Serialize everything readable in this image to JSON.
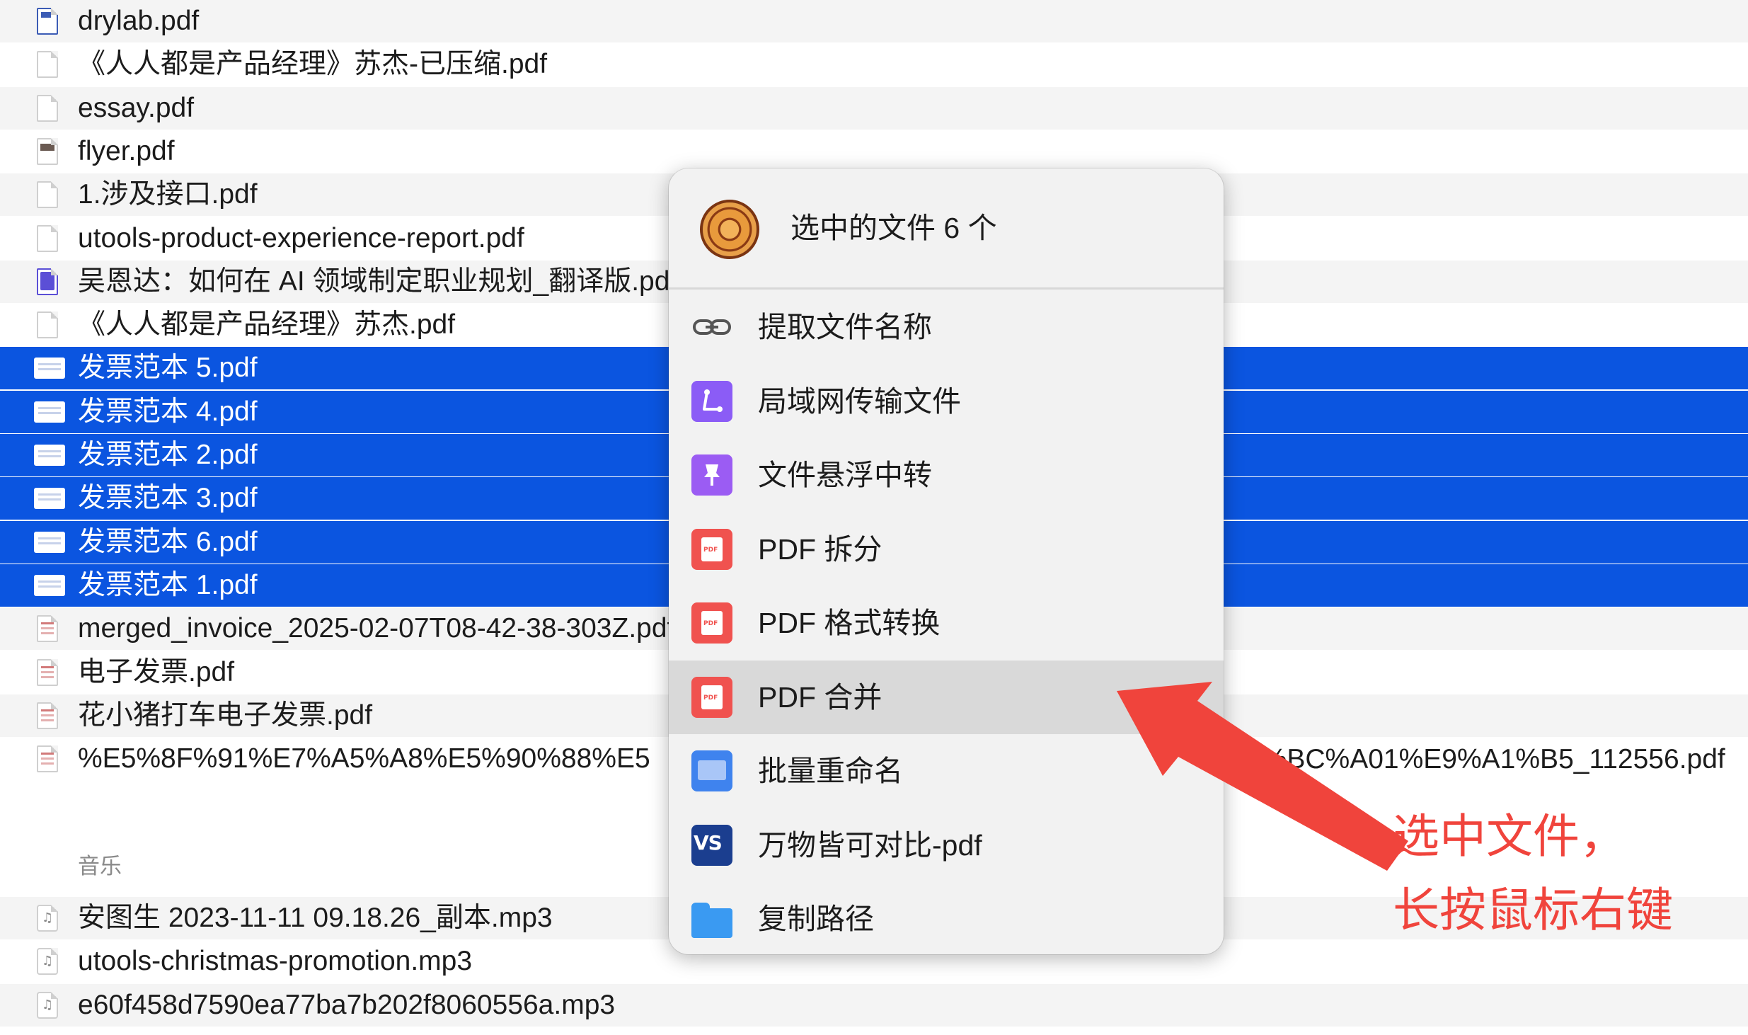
{
  "files": [
    {
      "name": "drylab.pdf",
      "icon": "pdf-doc-icon",
      "variant": "pdf-blue",
      "stripe": true,
      "selected": false
    },
    {
      "name": "《人人都是产品经理》苏杰-已压缩.pdf",
      "icon": "pdf-doc-icon",
      "variant": "",
      "stripe": false,
      "selected": false
    },
    {
      "name": "essay.pdf",
      "icon": "pdf-doc-icon",
      "variant": "",
      "stripe": true,
      "selected": false
    },
    {
      "name": "flyer.pdf",
      "icon": "pdf-doc-icon",
      "variant": "pdf-photo",
      "stripe": false,
      "selected": false
    },
    {
      "name": "1.涉及接口.pdf",
      "icon": "pdf-doc-icon",
      "variant": "",
      "stripe": true,
      "selected": false
    },
    {
      "name": "utools-product-experience-report.pdf",
      "icon": "pdf-doc-icon",
      "variant": "",
      "stripe": false,
      "selected": false
    },
    {
      "name": "吴恩达：如何在 AI 领域制定职业规划_翻译版.pdf",
      "icon": "pdf-doc-icon",
      "variant": "pdf-purple",
      "stripe": true,
      "selected": false
    },
    {
      "name": "《人人都是产品经理》苏杰.pdf",
      "icon": "pdf-doc-icon",
      "variant": "",
      "stripe": false,
      "selected": false
    },
    {
      "name": "发票范本 5.pdf",
      "icon": "invoice-icon",
      "variant": "",
      "stripe": false,
      "selected": true
    },
    {
      "name": "发票范本 4.pdf",
      "icon": "invoice-icon",
      "variant": "",
      "stripe": false,
      "selected": true
    },
    {
      "name": "发票范本 2.pdf",
      "icon": "invoice-icon",
      "variant": "",
      "stripe": false,
      "selected": true
    },
    {
      "name": "发票范本 3.pdf",
      "icon": "invoice-icon",
      "variant": "",
      "stripe": false,
      "selected": true
    },
    {
      "name": "发票范本 6.pdf",
      "icon": "invoice-icon",
      "variant": "",
      "stripe": false,
      "selected": true
    },
    {
      "name": "发票范本 1.pdf",
      "icon": "invoice-icon",
      "variant": "",
      "stripe": false,
      "selected": true
    },
    {
      "name": "merged_invoice_2025-02-07T08-42-38-303Z.pdf",
      "icon": "invoice-icon",
      "variant": "invoice",
      "stripe": true,
      "selected": false
    },
    {
      "name": "电子发票.pdf",
      "icon": "invoice-icon",
      "variant": "invoice",
      "stripe": false,
      "selected": false
    },
    {
      "name": "花小猪打车电子发票.pdf",
      "icon": "invoice-icon",
      "variant": "invoice",
      "stripe": true,
      "selected": false
    },
    {
      "name": "%E5%8F%91%E7%A5%A8%E5%90%88%E5",
      "icon": "invoice-icon",
      "variant": "invoice",
      "stripe": false,
      "selected": false
    }
  ],
  "long_file_tail": "5%BC%A01%E9%A1%B5_112556.pdf",
  "section_music": "音乐",
  "music_files": [
    {
      "name": "安图生 2023-11-11 09.18.26_副本.mp3",
      "stripe": true
    },
    {
      "name": "utools-christmas-promotion.mp3",
      "stripe": false
    },
    {
      "name": "e60f458d7590ea77ba7b202f8060556a.mp3",
      "stripe": true
    }
  ],
  "context_menu": {
    "header_title": "选中的文件 6 个",
    "items": [
      {
        "label": "提取文件名称",
        "icon": "link-icon",
        "hover": false
      },
      {
        "label": "局域网传输文件",
        "icon": "lan-transfer-icon",
        "hover": false
      },
      {
        "label": "文件悬浮中转",
        "icon": "pin-icon",
        "hover": false
      },
      {
        "label": "PDF 拆分",
        "icon": "pdf-icon",
        "hover": false
      },
      {
        "label": "PDF 格式转换",
        "icon": "pdf-icon",
        "hover": false
      },
      {
        "label": "PDF 合并",
        "icon": "pdf-icon",
        "hover": true
      },
      {
        "label": "批量重命名",
        "icon": "batch-rename-icon",
        "hover": false
      },
      {
        "label": "万物皆可对比-pdf",
        "icon": "vs-compare-icon",
        "hover": false
      },
      {
        "label": "复制路径",
        "icon": "folder-icon",
        "hover": false
      }
    ]
  },
  "annotation": {
    "line1": "选中文件，",
    "line2": "长按鼠标右键",
    "color": "#f0443c"
  },
  "colors": {
    "selection": "#0b55e0",
    "stripe": "#f4f4f4",
    "menu_bg": "#f2f2f2",
    "menu_hover": "#d9d9d9"
  }
}
